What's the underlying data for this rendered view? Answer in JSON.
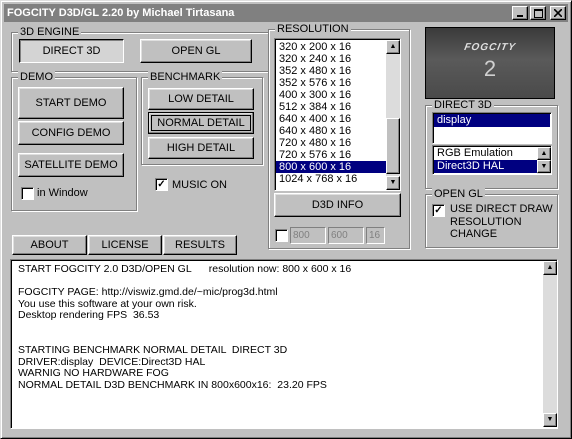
{
  "window": {
    "title": "FOGCITY D3D/GL 2.20 by Michael Tirtasana"
  },
  "engine": {
    "label": "3D ENGINE",
    "direct3d": "DIRECT 3D",
    "opengl": "OPEN GL"
  },
  "demo": {
    "label": "DEMO",
    "start": "START DEMO",
    "config": "CONFIG DEMO",
    "satellite": "SATELLITE DEMO",
    "in_window": "in Window"
  },
  "benchmark": {
    "label": "BENCHMARK",
    "low": "LOW DETAIL",
    "normal": "NORMAL DETAIL",
    "high": "HIGH DETAIL",
    "music": "MUSIC ON"
  },
  "resolution": {
    "label": "RESOLUTION",
    "items": [
      "320 x 200 x 16",
      "320 x 240 x 16",
      "352 x 480 x 16",
      "352 x 576 x 16",
      "400 x 300 x 16",
      "512 x 384 x 16",
      "640 x 400 x 16",
      "640 x 480 x 16",
      "720 x 480 x 16",
      "720 x 576 x 16",
      "800 x 600 x 16",
      "1024 x 768 x 16"
    ],
    "selected": "800 x 600 x 16",
    "d3d_info": "D3D INFO",
    "custom_w": "800",
    "custom_h": "600",
    "custom_bpp": "16"
  },
  "logo": {
    "text": "FOGCITY",
    "number": "2"
  },
  "direct3d": {
    "label": "DIRECT 3D",
    "drivers": [
      "display"
    ],
    "devices": [
      "RGB Emulation",
      "Direct3D HAL"
    ]
  },
  "opengl": {
    "label": "OPEN GL",
    "use_direct_draw": "USE DIRECT DRAW RESOLUTION CHANGE"
  },
  "tabs": {
    "about": "ABOUT",
    "license": "LICENSE",
    "results": "RESULTS"
  },
  "console": {
    "lines": [
      "START FOGCITY 2.0 D3D/OPEN GL      resolution now: 800 x 600 x 16",
      "",
      "FOGCITY PAGE: http://viswiz.gmd.de/~mic/prog3d.html",
      "You use this software at your own risk.",
      "Desktop rendering FPS  36.53",
      "",
      "",
      "STARTING BENCHMARK NORMAL DETAIL  DIRECT 3D",
      "DRIVER:display  DEVICE:Direct3D HAL",
      "WARNIG NO HARDWARE FOG",
      "NORMAL DETAIL D3D BENCHMARK IN 800x600x16:  23.20 FPS"
    ]
  },
  "icons": {
    "minimize": "minimize-icon",
    "maximize": "maximize-icon",
    "close": "close-icon",
    "scroll_up": "arrow-up-icon",
    "scroll_down": "arrow-down-icon"
  },
  "colors": {
    "selection": "#000080",
    "face": "#c0c0c0",
    "title_inactive": "#808080"
  }
}
